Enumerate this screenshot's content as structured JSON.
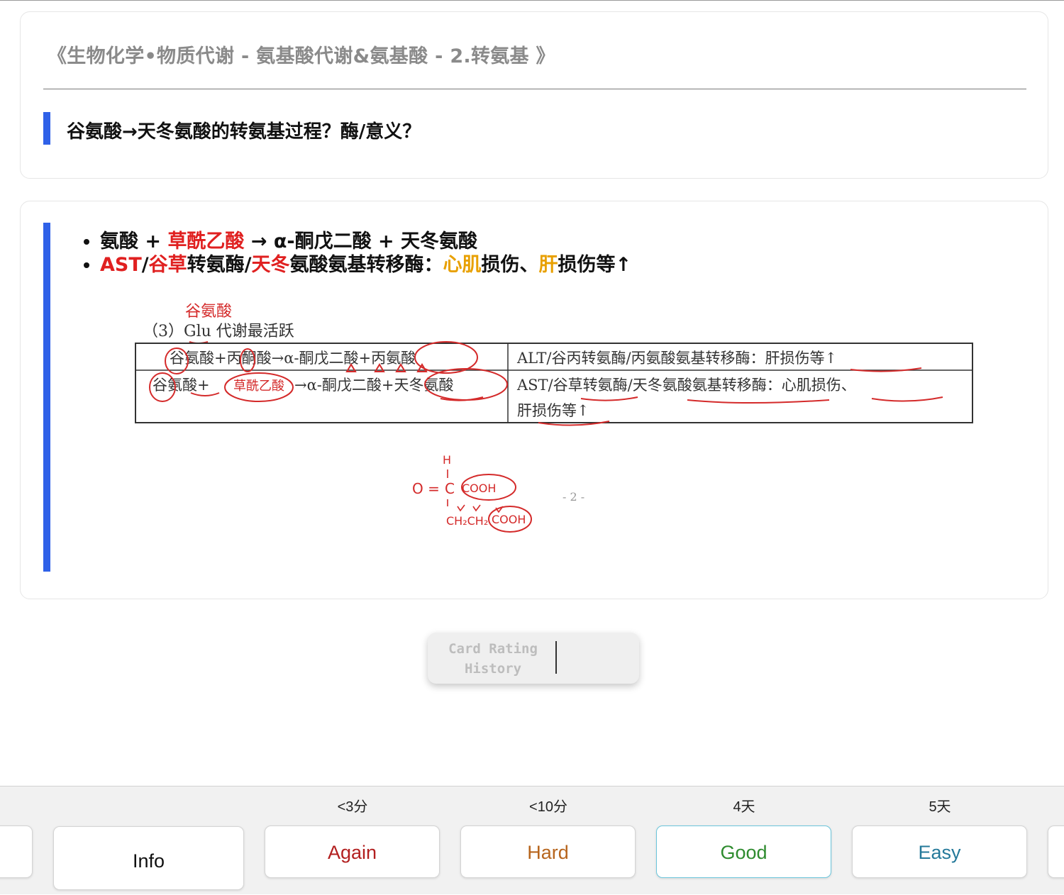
{
  "deck_title": "《生物化学•物质代谢 - 氨基酸代谢&氨基酸 - 2.转氨基 》",
  "question": "谷氨酸→天冬氨酸的转氨基过程？酶/意义？",
  "answer": {
    "line1": {
      "part1": "氨酸 + ",
      "part2_red": "草酰乙酸",
      "part3": " → α-酮戊二酸 + 天冬氨酸"
    },
    "line2": {
      "red1": "AST",
      "s1": "/",
      "red2": "谷草",
      "s2": "转氨酶/",
      "red3": "天冬",
      "s3": "氨酸氨基转移酶：",
      "orange1": "心肌",
      "s4": "损伤、",
      "orange2": "肝",
      "s5": "损伤等↑"
    }
  },
  "notes_image": {
    "handwritten_top": "谷氨酸",
    "heading": "（3）Glu 代谢最活跃",
    "table": [
      [
        "谷氨酸+丙酮酸→α-酮戊二酸+丙氨酸",
        "ALT/谷丙转氨酶/丙氨酸氨基转移酶：肝损伤等↑"
      ],
      [
        "谷氨酸+",
        "草酰乙酸",
        "→α-酮戊二酸+天冬氨酸",
        "AST/谷草转氨酶/天冬氨酸氨基转移酶：心肌损伤、",
        "肝损伤等↑"
      ]
    ],
    "chem_H": "H",
    "chem_O": "O =",
    "chem_C": "C",
    "chem_COOH1": "COOH",
    "chem_CH2CH2": "CH₂CH₂",
    "chem_COOH2": "COOH",
    "page_number": "- 2 -"
  },
  "rating_history": {
    "label": "Card Rating History"
  },
  "bottom_bar": {
    "info_label": "Info",
    "again": {
      "label": "Again",
      "interval": "<3分"
    },
    "hard": {
      "label": "Hard",
      "interval": "<10分"
    },
    "good": {
      "label": "Good",
      "interval": "4天"
    },
    "easy": {
      "label": "Easy",
      "interval": "5天"
    }
  },
  "colors": {
    "accent_blue": "#2f61e8",
    "emphasis_red": "#e02020",
    "emphasis_orange": "#e8a000",
    "again": "#b21f1f",
    "hard": "#b7651d",
    "good": "#2e8b2e",
    "easy": "#24799a"
  }
}
